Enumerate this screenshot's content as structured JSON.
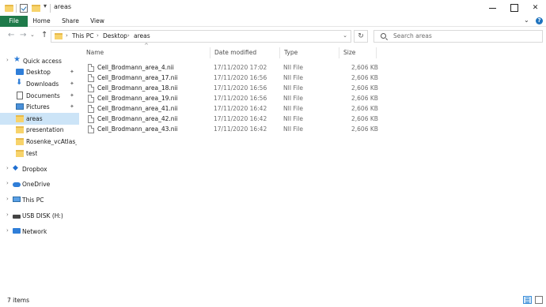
{
  "window": {
    "title": "areas"
  },
  "ribbon": {
    "tabs": [
      "File",
      "Home",
      "Share",
      "View"
    ]
  },
  "address": {
    "crumbs": [
      "This PC",
      "Desktop",
      "areas"
    ]
  },
  "search": {
    "placeholder": "Search areas"
  },
  "sidebar": {
    "items": [
      {
        "label": "Quick access",
        "icon": "star-icon",
        "pinned": false
      },
      {
        "label": "Desktop",
        "icon": "desktop-icon",
        "pinned": true
      },
      {
        "label": "Downloads",
        "icon": "download-icon",
        "pinned": true
      },
      {
        "label": "Documents",
        "icon": "document-icon",
        "pinned": true
      },
      {
        "label": "Pictures",
        "icon": "pictures-icon",
        "pinned": true
      },
      {
        "label": "areas",
        "icon": "folder-icon",
        "selected": true
      },
      {
        "label": "presentation",
        "icon": "folder-icon"
      },
      {
        "label": "Rosenke_vcAtlas_BV",
        "icon": "folder-icon"
      },
      {
        "label": "test",
        "icon": "folder-icon"
      },
      {
        "label": "Dropbox",
        "icon": "dropbox-icon"
      },
      {
        "label": "OneDrive",
        "icon": "cloud-icon"
      },
      {
        "label": "This PC",
        "icon": "computer-icon"
      },
      {
        "label": "USB DISK (H:)",
        "icon": "usb-drive-icon"
      },
      {
        "label": "Network",
        "icon": "network-icon"
      }
    ]
  },
  "columns": {
    "name": "Name",
    "date": "Date modified",
    "type": "Type",
    "size": "Size"
  },
  "files": [
    {
      "name": "Cell_Brodmann_area_4.nii",
      "date": "17/11/2020 17:02",
      "type": "NII File",
      "size": "2,606 KB"
    },
    {
      "name": "Cell_Brodmann_area_17.nii",
      "date": "17/11/2020 16:56",
      "type": "NII File",
      "size": "2,606 KB"
    },
    {
      "name": "Cell_Brodmann_area_18.nii",
      "date": "17/11/2020 16:56",
      "type": "NII File",
      "size": "2,606 KB"
    },
    {
      "name": "Cell_Brodmann_area_19.nii",
      "date": "17/11/2020 16:56",
      "type": "NII File",
      "size": "2,606 KB"
    },
    {
      "name": "Cell_Brodmann_area_41.nii",
      "date": "17/11/2020 16:42",
      "type": "NII File",
      "size": "2,606 KB"
    },
    {
      "name": "Cell_Brodmann_area_42.nii",
      "date": "17/11/2020 16:42",
      "type": "NII File",
      "size": "2,606 KB"
    },
    {
      "name": "Cell_Brodmann_area_43.nii",
      "date": "17/11/2020 16:42",
      "type": "NII File",
      "size": "2,606 KB"
    }
  ],
  "status": {
    "item_count": "7 items"
  },
  "colors": {
    "file_tab": "#1e7a4a",
    "selection": "#cce4f7",
    "folder": "#f7d36b"
  }
}
